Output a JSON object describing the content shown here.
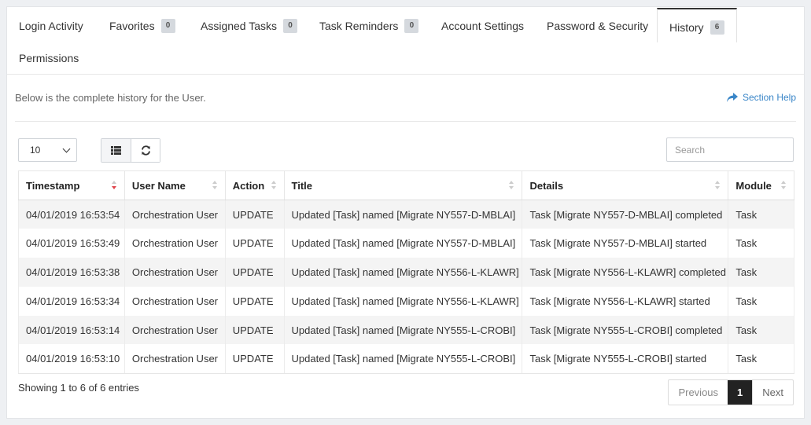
{
  "tabs": [
    {
      "label": "Login Activity"
    },
    {
      "label": "Favorites",
      "badge": "0"
    },
    {
      "label": "Assigned Tasks",
      "badge": "0"
    },
    {
      "label": "Task Reminders",
      "badge": "0"
    },
    {
      "label": "Account Settings"
    },
    {
      "label": "Password & Security"
    },
    {
      "label": "History",
      "badge": "6",
      "active": true
    },
    {
      "label": "Permissions"
    }
  ],
  "intro": "Below is the complete history for the User.",
  "section_help": "Section Help",
  "page_size": "10",
  "search": {
    "placeholder": "Search",
    "value": ""
  },
  "table": {
    "columns": [
      "Timestamp",
      "User Name",
      "Action",
      "Title",
      "Details",
      "Module"
    ],
    "sorted_column": "Timestamp",
    "sort_direction": "desc",
    "rows": [
      [
        "04/01/2019 16:53:54",
        "Orchestration User",
        "UPDATE",
        "Updated [Task] named [Migrate NY557-D-MBLAI]",
        "Task [Migrate NY557-D-MBLAI] completed",
        "Task"
      ],
      [
        "04/01/2019 16:53:49",
        "Orchestration User",
        "UPDATE",
        "Updated [Task] named [Migrate NY557-D-MBLAI]",
        "Task [Migrate NY557-D-MBLAI] started",
        "Task"
      ],
      [
        "04/01/2019 16:53:38",
        "Orchestration User",
        "UPDATE",
        "Updated [Task] named [Migrate NY556-L-KLAWR]",
        "Task [Migrate NY556-L-KLAWR] completed",
        "Task"
      ],
      [
        "04/01/2019 16:53:34",
        "Orchestration User",
        "UPDATE",
        "Updated [Task] named [Migrate NY556-L-KLAWR]",
        "Task [Migrate NY556-L-KLAWR] started",
        "Task"
      ],
      [
        "04/01/2019 16:53:14",
        "Orchestration User",
        "UPDATE",
        "Updated [Task] named [Migrate NY555-L-CROBI]",
        "Task [Migrate NY555-L-CROBI] completed",
        "Task"
      ],
      [
        "04/01/2019 16:53:10",
        "Orchestration User",
        "UPDATE",
        "Updated [Task] named [Migrate NY555-L-CROBI]",
        "Task [Migrate NY555-L-CROBI] started",
        "Task"
      ]
    ]
  },
  "info": "Showing 1 to 6 of 6 entries",
  "pagination": {
    "previous": "Previous",
    "current": "1",
    "next": "Next"
  },
  "colors": {
    "accent": "#3a86c8",
    "sort_active": "#e0434b",
    "active_page": "#222222"
  }
}
